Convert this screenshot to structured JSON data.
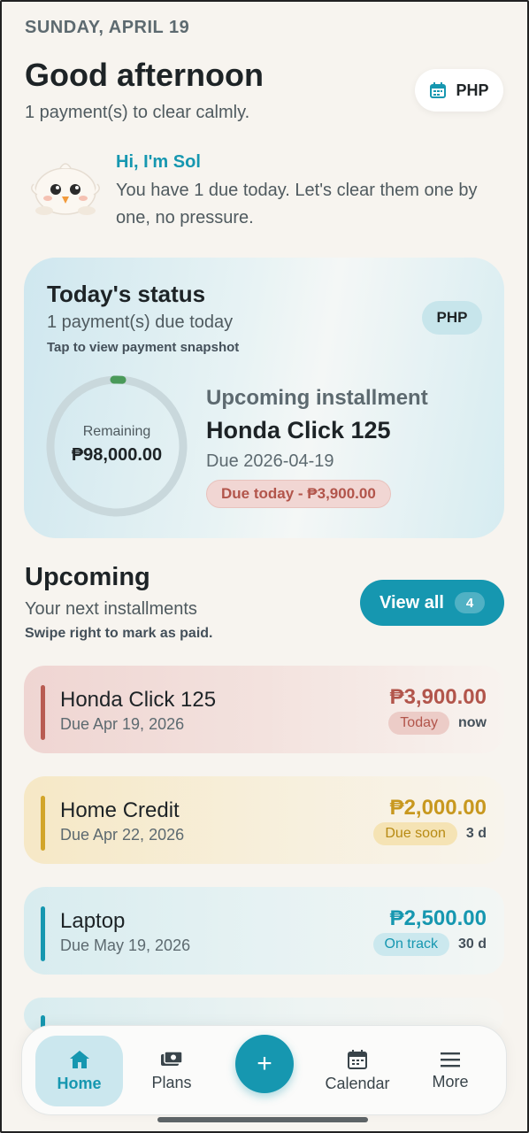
{
  "header": {
    "date": "SUNDAY, APRIL 19",
    "greeting": "Good afternoon",
    "subtitle": "1 payment(s) to clear calmly.",
    "currency_button": "PHP"
  },
  "assistant": {
    "name": "Hi, I'm Sol",
    "message": "You have 1 due today. Let's clear them one by one, no pressure."
  },
  "status_card": {
    "title": "Today's status",
    "subtitle": "1 payment(s) due today",
    "hint": "Tap to view payment snapshot",
    "currency": "PHP",
    "remaining_label": "Remaining",
    "remaining_value": "₱98,000.00",
    "upcoming_label": "Upcoming installment",
    "upcoming_name": "Honda Click 125",
    "upcoming_due": "Due 2026-04-19",
    "upcoming_badge": "Due today - ₱3,900.00"
  },
  "upcoming": {
    "title": "Upcoming",
    "subtitle": "Your next installments",
    "hint": "Swipe right to mark as paid.",
    "view_all_label": "View all",
    "view_all_count": "4",
    "items": [
      {
        "name": "Honda Click 125",
        "due": "Due Apr 19, 2026",
        "amount": "₱3,900.00",
        "badge": "Today",
        "remaining": "now"
      },
      {
        "name": "Home Credit",
        "due": "Due Apr 22, 2026",
        "amount": "₱2,000.00",
        "badge": "Due soon",
        "remaining": "3 d"
      },
      {
        "name": "Laptop",
        "due": "Due May 19, 2026",
        "amount": "₱2,500.00",
        "badge": "On track",
        "remaining": "30 d"
      }
    ]
  },
  "nav": {
    "home": "Home",
    "plans": "Plans",
    "add": "+",
    "calendar": "Calendar",
    "more": "More"
  },
  "colors": {
    "accent": "#1697b0",
    "due_today": "#b2554b",
    "due_soon": "#c8981f"
  }
}
